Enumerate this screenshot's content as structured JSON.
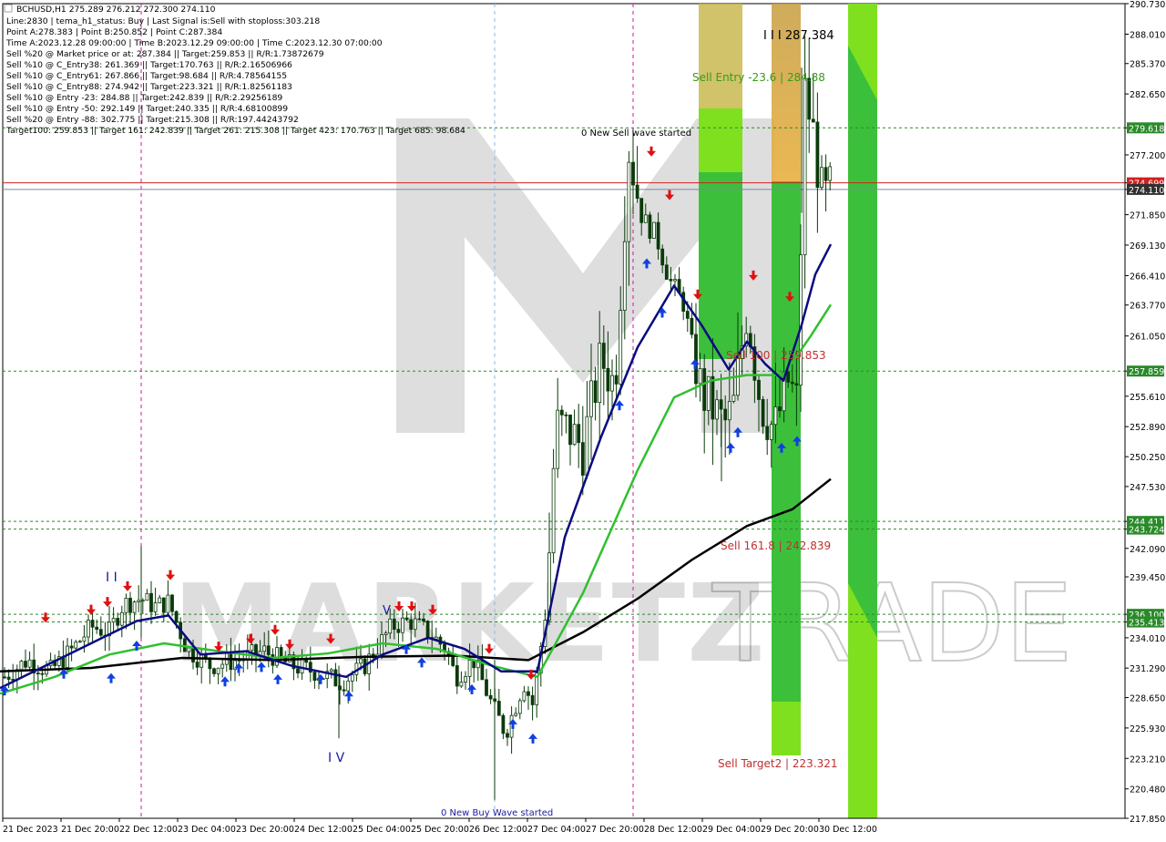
{
  "info_panel": {
    "symbol_line": "BCHUSD,H1  275.289 276.212 272.300 274.110",
    "lines": [
      "Line:2830  |  tema_h1_status: Buy  |  Last Signal is:Sell with stoploss:303.218",
      "Point A:278.383  |  Point B:250.852  |  Point C:287.384",
      "Time A:2023.12.28 09:00:00  |  Time B:2023.12.29 09:00:00  |  Time C:2023.12.30 07:00:00",
      "Sell %20 @ Market price or at: 287.384  ||  Target:259.853  ||  R/R:1.73872679",
      "Sell %10 @ C_Entry38: 261.369  ||  Target:170.763  ||  R/R:2.16506966",
      "Sell %10 @ C_Entry61: 267.866  ||  Target:98.684  ||  R/R:4.78564155",
      "Sell %10 @ C_Entry88: 274.942  ||  Target:223.321  ||  R/R:1.82561183",
      "Sell %10 @ Entry -23: 284.88  ||  Target:242.839  ||  R/R:2.29256189",
      "Sell %10 @ Entry -50: 292.149  ||  Target:240.335  ||  R/R:4.68100899",
      "Sell %20 @ Entry -88: 302.775  ||  Target:215.308  ||  R/R:197.44243792",
      "Target100: 259.853  ||  Target 161: 242.839  ||  Target 261: 215.308  ||  Target 423: 170.763  ||  Target 685: 98.684"
    ]
  },
  "watermark": {
    "text_left": "MARKETZI",
    "text_right": "TRADE"
  },
  "chart_data": {
    "type": "candlestick",
    "symbol": "BCHUSD",
    "timeframe": "H1",
    "ylim": [
      217.85,
      290.73
    ],
    "y_ticks": [
      290.73,
      288.0,
      285.37,
      282.65,
      279.618,
      277.2,
      274.699,
      274.11,
      271.85,
      269.13,
      266.4,
      263.77,
      261.0,
      257.859,
      255.61,
      252.89,
      250.2,
      247.53,
      244.411,
      243.724,
      242.0,
      239.45,
      236.1,
      235.413,
      234.0,
      231.29,
      228.65,
      225.93,
      223.21,
      220.48,
      217.85
    ],
    "y_tick_labels": [
      "290.730",
      "288.010",
      "285.370",
      "282.650",
      "279.618",
      "277.200",
      "274.699",
      "274.110",
      "271.850",
      "269.130",
      "266.410",
      "263.770",
      "261.050",
      "257.859",
      "255.610",
      "252.890",
      "250.250",
      "247.530",
      "244.411",
      "243.724",
      "242.090",
      "239.450",
      "236.100",
      "235.413",
      "234.010",
      "231.290",
      "228.650",
      "225.930",
      "223.210",
      "220.480",
      "217.850"
    ],
    "x_tick_labels": [
      "21 Dec 2023",
      "21 Dec 20:00",
      "22 Dec 12:00",
      "23 Dec 04:00",
      "23 Dec 20:00",
      "24 Dec 12:00",
      "25 Dec 04:00",
      "25 Dec 20:00",
      "26 Dec 12:00",
      "27 Dec 04:00",
      "27 Dec 20:00",
      "28 Dec 12:00",
      "29 Dec 04:00",
      "29 Dec 20:00",
      "30 Dec 12:00"
    ],
    "current_price": 274.11,
    "bid_line": 274.699,
    "horizontal_levels": [
      {
        "price": 279.618,
        "label": "279.618",
        "color": "#2a8a2a"
      },
      {
        "price": 257.859,
        "label": "257.859",
        "color": "#2a8a2a"
      },
      {
        "price": 244.411,
        "label": "244.411",
        "color": "#2a8a2a"
      },
      {
        "price": 243.724,
        "label": "243.724",
        "color": "#2a8a2a"
      },
      {
        "price": 236.1,
        "label": "236.100",
        "color": "#2a8a2a"
      },
      {
        "price": 235.413,
        "label": "235.413",
        "color": "#2a8a2a"
      }
    ],
    "annotations": [
      {
        "text": "I I I 287.384",
        "color": "#000000"
      },
      {
        "text": "Sell Entry -23.6 | 284.88",
        "color": "#3a9a1a"
      },
      {
        "text": "0 New Sell wave started",
        "color": "#000000"
      },
      {
        "text": "Sell 100 | 259.853",
        "color": "#c03030"
      },
      {
        "text": "Sell 161.8 | 242.839",
        "color": "#c03030"
      },
      {
        "text": "Sell Target2 | 223.321",
        "color": "#c03030"
      },
      {
        "text": "0 New Buy Wave started",
        "color": "#1a1aa0"
      },
      {
        "text": "I V",
        "color": "#1a1aa0"
      },
      {
        "text": "I I",
        "color": "#1a1aa0"
      },
      {
        "text": "V",
        "color": "#1a1aa0"
      }
    ],
    "colors": {
      "bull": "#0a3a0a",
      "bear": "#0a3a0a",
      "ma_fast": "#0a0a80",
      "ma_mid": "#30c030",
      "ma_slow": "#000000",
      "bid_line": "#d02020",
      "level": "#2a8a2a",
      "sell_arrow": "#e01010",
      "buy_arrow": "#1040e0"
    }
  }
}
